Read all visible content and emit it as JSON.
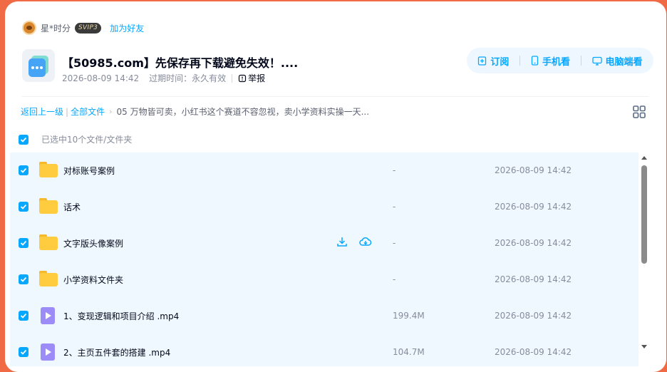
{
  "user": {
    "name": "星*时分",
    "vip": "SVIP3",
    "add_friend": "加为好友"
  },
  "share": {
    "title": "【50985.com】先保存再下载避免失效！....",
    "date": "2026-08-09 14:42",
    "expire_label": "过期时间：",
    "expire_value": "永久有效",
    "report": "举报"
  },
  "actions": {
    "subscribe": "订阅",
    "mobile": "手机看",
    "desktop": "电脑端看"
  },
  "breadcrumb": {
    "back": "返回上一级",
    "all_files": "全部文件",
    "current": "05 万物皆可卖，小红书这个赛道不容忽视，卖小学资料实操一天..."
  },
  "selection": {
    "label": "已选中10个文件/文件夹"
  },
  "files": [
    {
      "name": "对标账号案例",
      "size": "-",
      "time": "2026-08-09 14:42",
      "type": "folder"
    },
    {
      "name": "话术",
      "size": "-",
      "time": "2026-08-09 14:42",
      "type": "folder"
    },
    {
      "name": "文字版头像案例",
      "size": "-",
      "time": "2026-08-09 14:42",
      "type": "folder"
    },
    {
      "name": "小学资料文件夹",
      "size": "-",
      "time": "2026-08-09 14:42",
      "type": "folder"
    },
    {
      "name": "1、变现逻辑和项目介绍 .mp4",
      "size": "199.4M",
      "time": "2026-08-09 14:42",
      "type": "video"
    },
    {
      "name": "2、主页五件套的搭建 .mp4",
      "size": "104.7M",
      "time": "2026-08-09 14:42",
      "type": "video"
    }
  ],
  "colors": {
    "accent": "#06a7ff",
    "background": "#f06a45",
    "row_selected": "#f0f8ff"
  }
}
